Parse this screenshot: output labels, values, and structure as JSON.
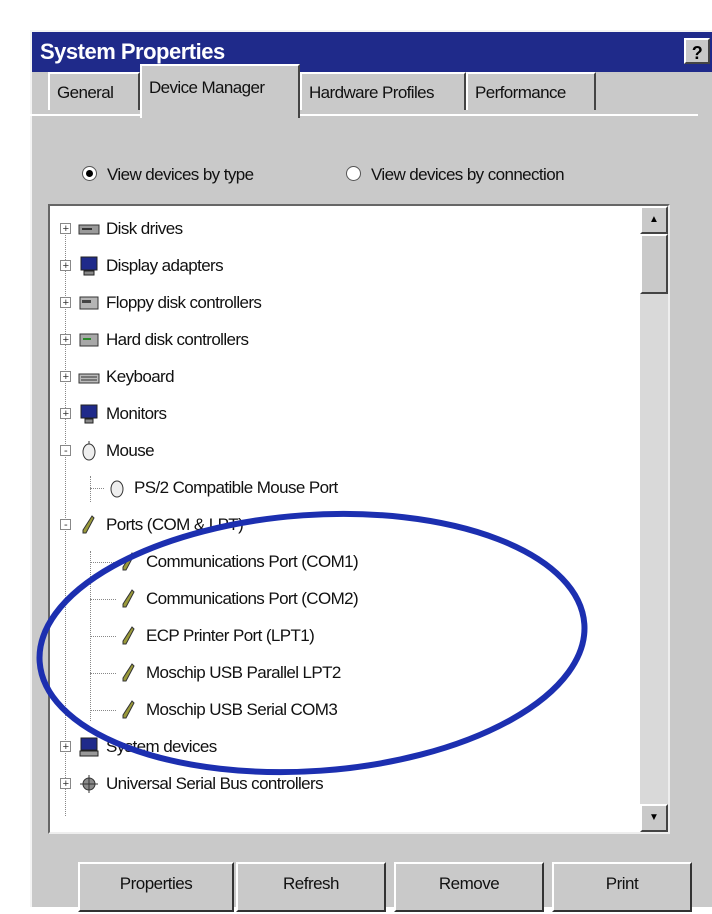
{
  "window": {
    "title": "System Properties",
    "help_label": "?"
  },
  "tabs": [
    {
      "label": "General",
      "active": false
    },
    {
      "label": "Device Manager",
      "active": true
    },
    {
      "label": "Hardware Profiles",
      "active": false
    },
    {
      "label": "Performance",
      "active": false
    }
  ],
  "view_options": {
    "by_type": {
      "label": "View devices by type",
      "checked": true
    },
    "by_connection": {
      "label": "View devices by connection",
      "checked": false
    }
  },
  "tree": {
    "items": [
      {
        "label": "Disk drives",
        "icon": "disk-drive-icon",
        "expander": "+"
      },
      {
        "label": "Display adapters",
        "icon": "display-adapter-icon",
        "expander": "+"
      },
      {
        "label": "Floppy disk controllers",
        "icon": "floppy-controller-icon",
        "expander": "+"
      },
      {
        "label": "Hard disk controllers",
        "icon": "hard-disk-controller-icon",
        "expander": "+"
      },
      {
        "label": "Keyboard",
        "icon": "keyboard-icon",
        "expander": "+"
      },
      {
        "label": "Monitors",
        "icon": "monitor-icon",
        "expander": "+"
      },
      {
        "label": "Mouse",
        "icon": "mouse-icon",
        "expander": "-"
      },
      {
        "label": "PS/2 Compatible Mouse Port",
        "icon": "mouse-icon",
        "child": true
      },
      {
        "label": "Ports (COM & LPT)",
        "icon": "port-icon",
        "expander": "-"
      },
      {
        "label": "Communications Port (COM1)",
        "icon": "port-icon",
        "child": true
      },
      {
        "label": "Communications Port (COM2)",
        "icon": "port-icon",
        "child": true
      },
      {
        "label": "ECP Printer Port (LPT1)",
        "icon": "port-icon",
        "child": true
      },
      {
        "label": "Moschip USB Parallel LPT2",
        "icon": "port-icon",
        "child": true
      },
      {
        "label": "Moschip USB Serial COM3",
        "icon": "port-icon",
        "child": true
      },
      {
        "label": "System devices",
        "icon": "system-device-icon",
        "expander": "+"
      },
      {
        "label": "Universal Serial Bus controllers",
        "icon": "usb-icon",
        "expander": "+"
      }
    ]
  },
  "buttons": {
    "properties": "Properties",
    "refresh": "Refresh",
    "remove": "Remove",
    "print": "Print"
  },
  "colors": {
    "titlebar": "#1f2a8a",
    "annotation_ellipse": "#1c2fb0"
  }
}
